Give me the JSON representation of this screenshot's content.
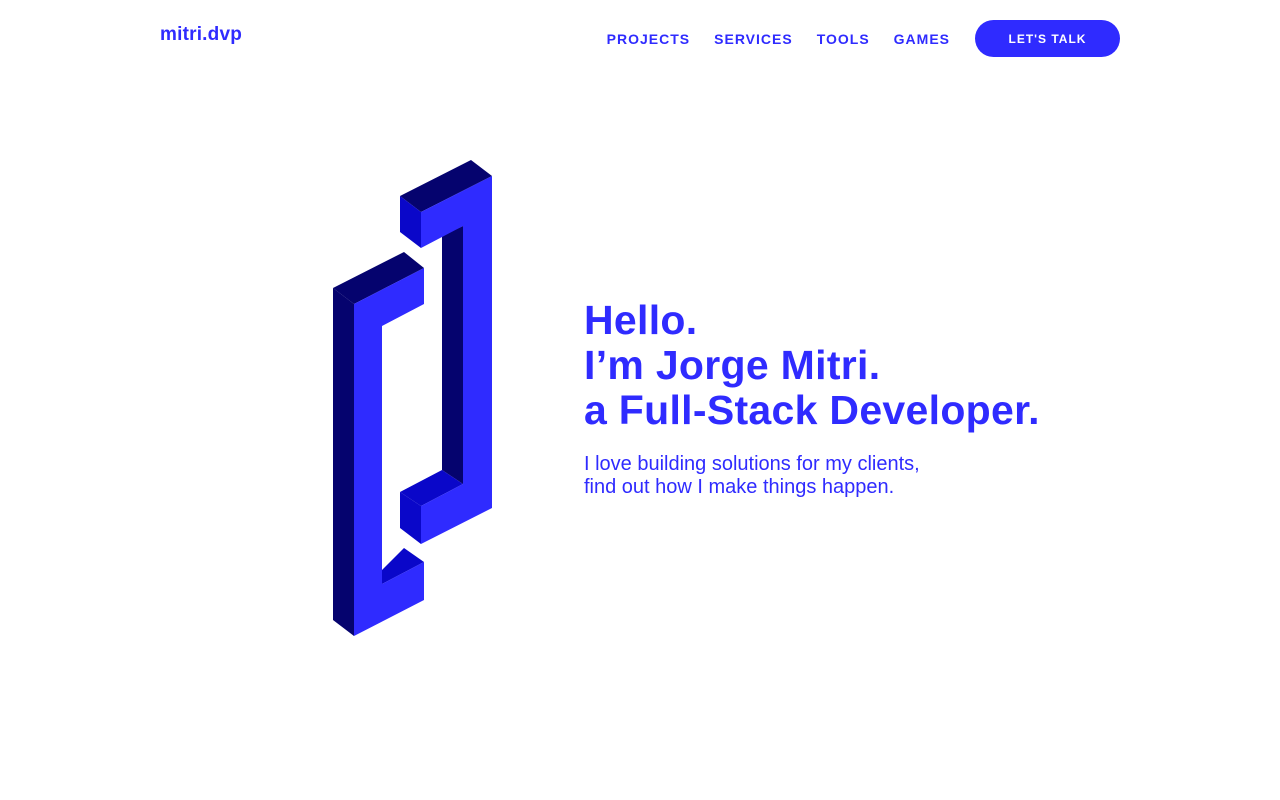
{
  "header": {
    "logo": "mitri.dvp",
    "nav": [
      {
        "label": "PROJECTS"
      },
      {
        "label": "SERVICES"
      },
      {
        "label": "TOOLS"
      },
      {
        "label": "GAMES"
      }
    ],
    "cta_label": "LET'S TALK"
  },
  "hero": {
    "graphic_icon": "isometric-bracket-logo-icon",
    "headline": [
      "Hello.",
      "I’m Jorge Mitri.",
      "a Full-Stack Developer."
    ],
    "tagline": [
      "I love building solutions for my clients,",
      "find out how I make things happen."
    ]
  },
  "colors": {
    "brand": "#2f2bff",
    "brand_mid": "#0a07c9",
    "brand_dark": "#05036e",
    "background": "#ffffff"
  }
}
